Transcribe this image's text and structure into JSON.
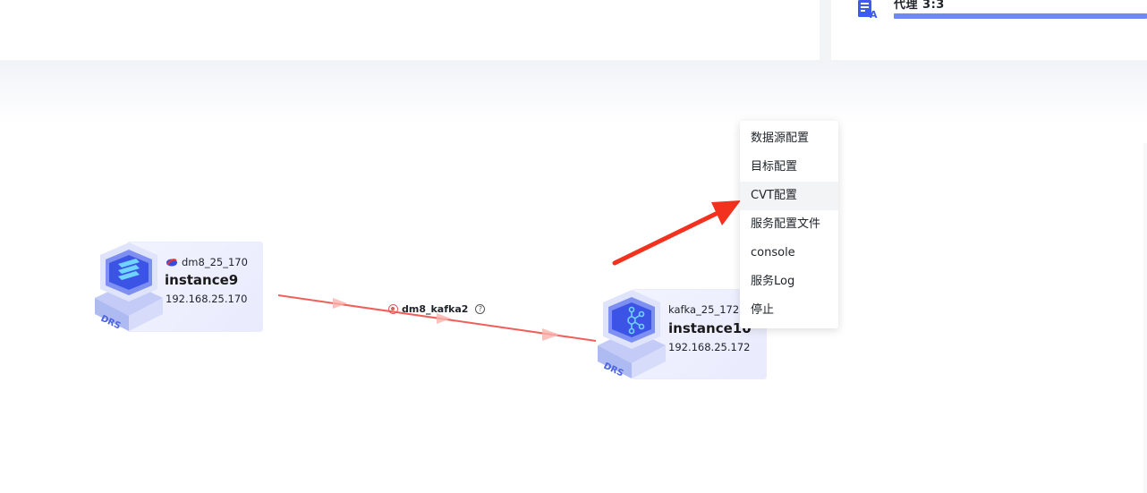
{
  "header": {
    "proxy_label": "代理 3:3",
    "proxy_progress": 1.0,
    "accent_color": "#6e88f5"
  },
  "nodes": [
    {
      "source_icon": "dm8-db-icon",
      "source_name": "dm8_25_170",
      "instance_name": "instance9",
      "ip": "192.168.25.170",
      "badge": "DRS"
    },
    {
      "source_icon": "kafka-icon",
      "source_name": "kafka_25_172",
      "instance_name": "instance10",
      "ip": "192.168.25.172",
      "badge": "DRS"
    }
  ],
  "link": {
    "name": "dm8_kafka2",
    "status": "error",
    "status_color": "#e25b5b",
    "help_glyph": "?"
  },
  "context_menu": {
    "items": [
      {
        "label": "数据源配置"
      },
      {
        "label": "目标配置"
      },
      {
        "label": "CVT配置"
      },
      {
        "label": "服务配置文件"
      },
      {
        "label": "console"
      },
      {
        "label": "服务Log"
      },
      {
        "label": "停止"
      }
    ],
    "active_index": 2
  },
  "annotation": {
    "arrow_color": "#f2311f"
  }
}
